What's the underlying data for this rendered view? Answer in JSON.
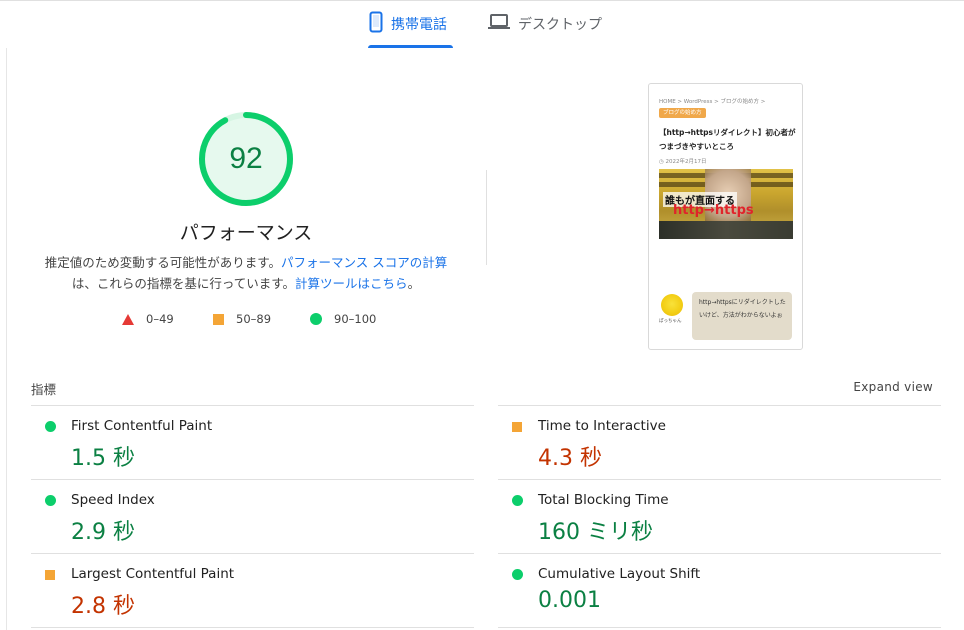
{
  "tabs": {
    "mobile": "携帯電話",
    "desktop": "デスクトップ"
  },
  "score": {
    "value": "92",
    "fraction": 0.92,
    "title": "パフォーマンス",
    "desc_prefix": "推定値のため変動する可能性があります。",
    "desc_link1": "パフォーマンス スコアの計算",
    "desc_middle": "は、これらの指標を基に行っています。",
    "desc_link2": "計算ツールはこちら",
    "desc_end": "。"
  },
  "legend": {
    "fail": "0–49",
    "average": "50–89",
    "pass": "90–100"
  },
  "thumbnail": {
    "breadcrumb": "HOME > WordPress > ブログの始め方 >",
    "category": "ブログの始め方",
    "title": "【http→httpsリダイレクト】初心者がつまづきやすいところ",
    "date": "◷ 2022年2月17日",
    "image_line1": "誰もが直面する",
    "image_line2": "http→https",
    "avatar_name": "ぽっちゃん",
    "bubble": "http→httpsにリダイレクトしたいけど、方法がわからないよぉ"
  },
  "metrics_section": {
    "label": "指標",
    "expand": "Expand view"
  },
  "metrics": {
    "fcp": {
      "name": "First Contentful Paint",
      "value": "1.5 秒"
    },
    "si": {
      "name": "Speed Index",
      "value": "2.9 秒"
    },
    "lcp": {
      "name": "Largest Contentful Paint",
      "value": "2.8 秒"
    },
    "tti": {
      "name": "Time to Interactive",
      "value": "4.3 秒"
    },
    "tbt": {
      "name": "Total Blocking Time",
      "value": "160 ミリ秒"
    },
    "cls": {
      "name": "Cumulative Layout Shift",
      "value": "0.001"
    }
  },
  "colors": {
    "pass": "#0cce6b",
    "average": "#f4a536",
    "fail": "#e53935",
    "accent": "#1a73e8"
  }
}
